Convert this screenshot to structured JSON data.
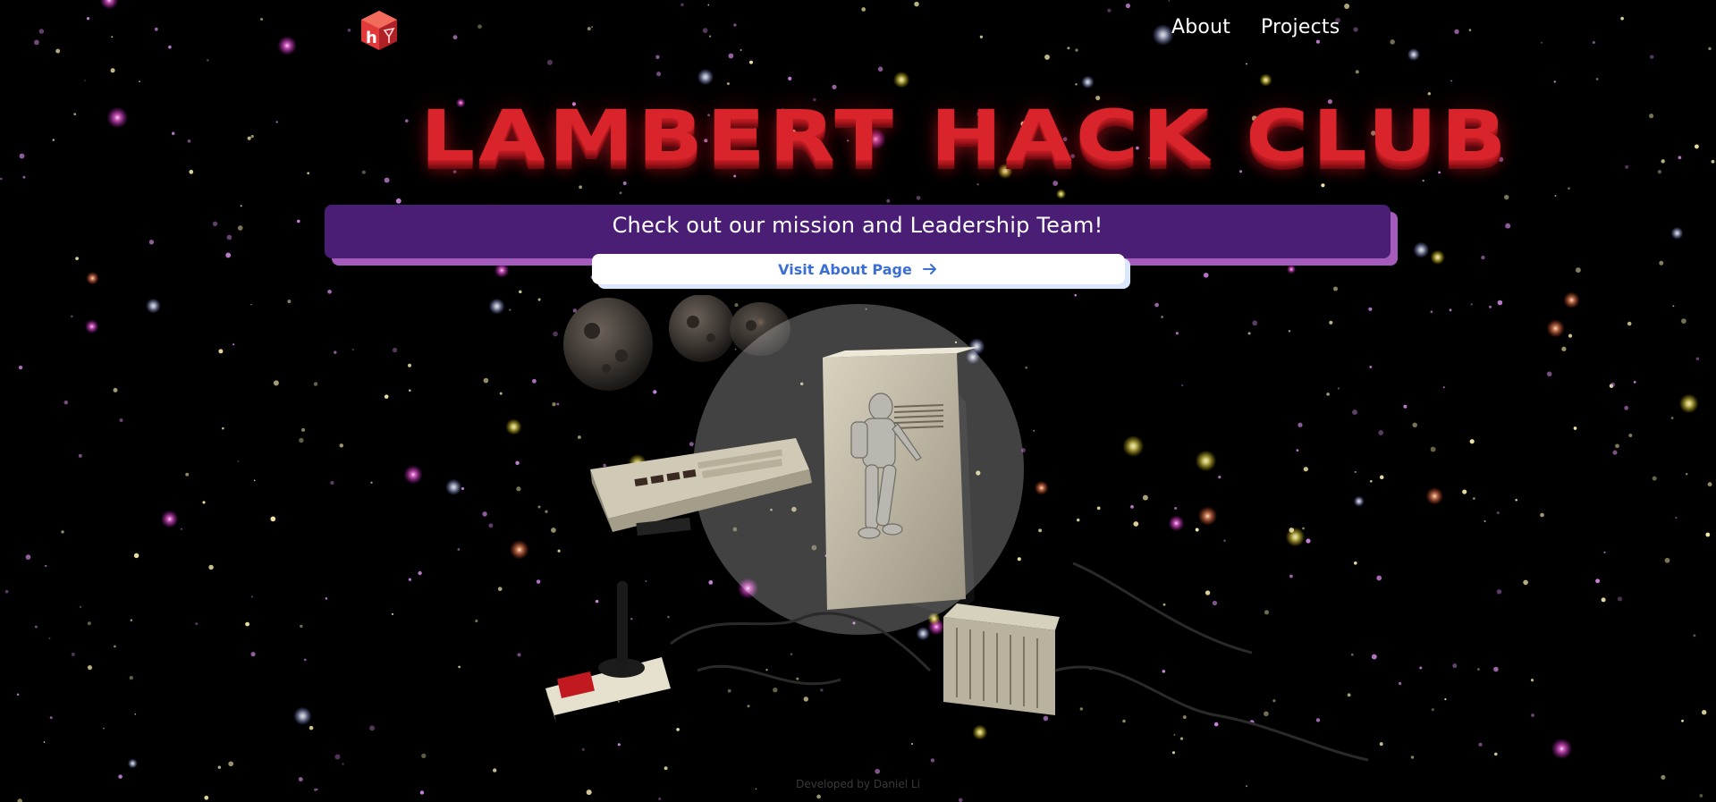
{
  "header": {
    "logo_letter": "h",
    "nav": [
      {
        "label": "About"
      },
      {
        "label": "Projects"
      }
    ]
  },
  "hero": {
    "title": "LAMBERT HACK CLUB",
    "banner_text": "Check out our mission and Leadership Team!",
    "cta_label": "Visit About Page"
  },
  "footer": {
    "credit": "Developed by Daniel Li"
  },
  "colors": {
    "background": "#000000",
    "title_red": "#d9242c",
    "banner_purple": "#4a1e74",
    "banner_shadow": "#a55bbc",
    "cta_text": "#3c6fd6",
    "logo_red": "#e23a3a"
  },
  "icons": {
    "logo": "hack-club-cube-logo",
    "cta_arrow": "arrow-right-icon"
  }
}
